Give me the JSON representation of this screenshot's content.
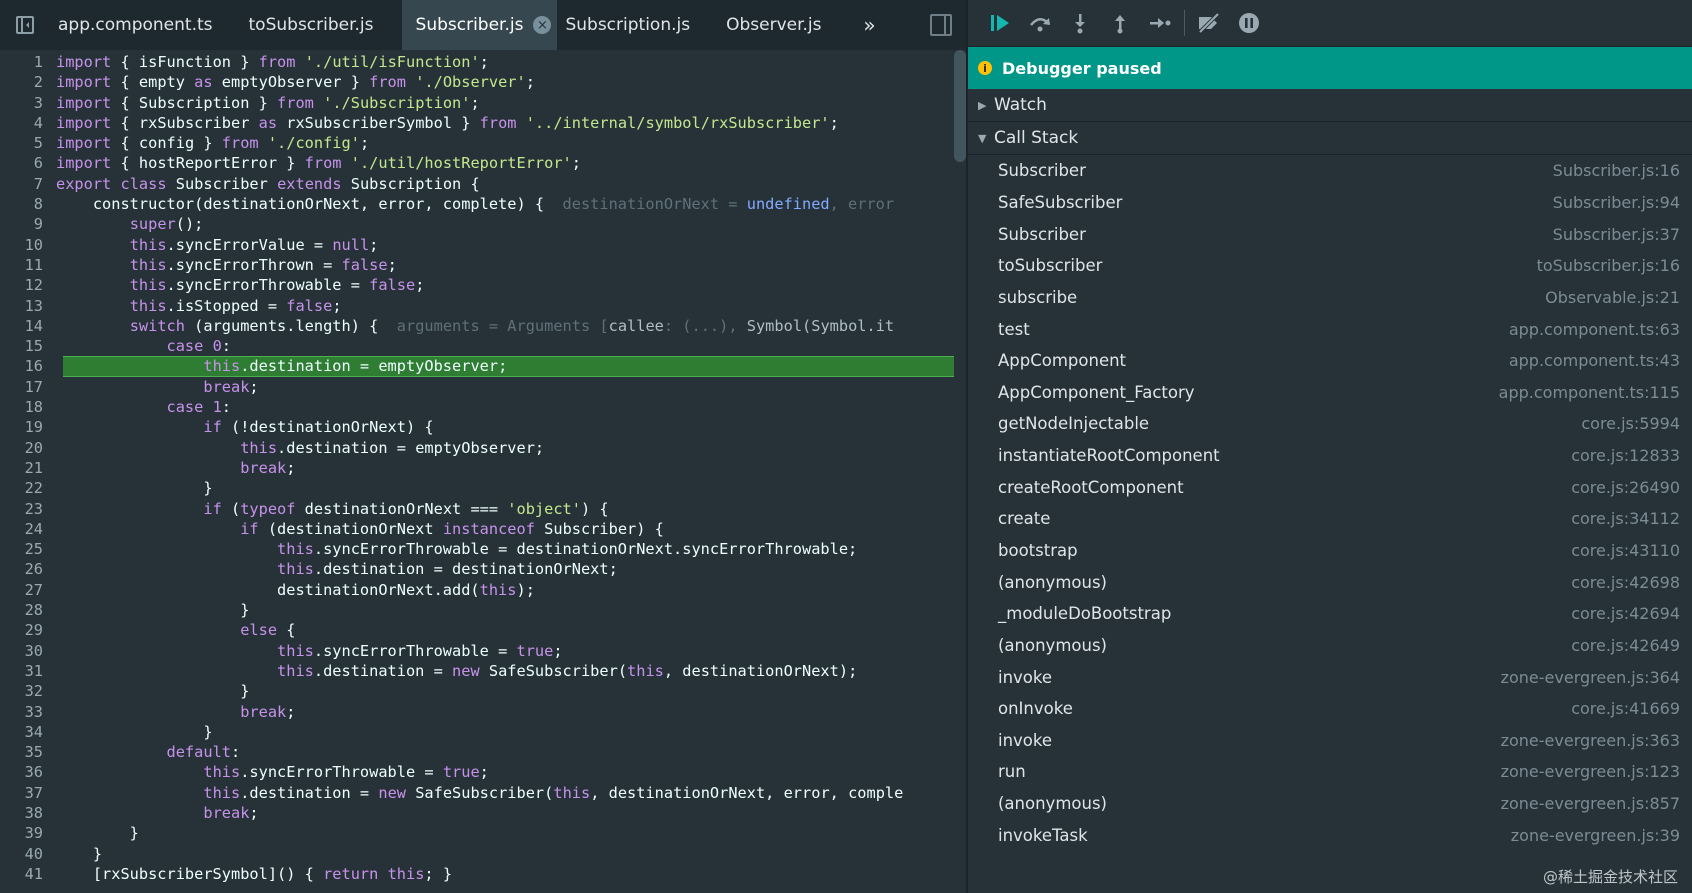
{
  "tabs": [
    {
      "label": "app.component.ts",
      "active": false
    },
    {
      "label": "toSubscriber.js",
      "active": false
    },
    {
      "label": "Subscriber.js",
      "active": true
    },
    {
      "label": "Subscription.js",
      "active": false
    },
    {
      "label": "Observer.js",
      "active": false
    }
  ],
  "tab_overflow_label": "»",
  "tab_close_glyph": "×",
  "code_lines": [
    {
      "n": "1",
      "html": "<span class=\"k\">import</span> { isFunction } <span class=\"k\">from</span> <span class=\"s\">'./util/isFunction'</span>;"
    },
    {
      "n": "2",
      "html": "<span class=\"k\">import</span> { empty <span class=\"k\">as</span> emptyObserver } <span class=\"k\">from</span> <span class=\"s\">'./Observer'</span>;"
    },
    {
      "n": "3",
      "html": "<span class=\"k\">import</span> { Subscription } <span class=\"k\">from</span> <span class=\"s\">'./Subscription'</span>;"
    },
    {
      "n": "4",
      "html": "<span class=\"k\">import</span> { rxSubscriber <span class=\"k\">as</span> rxSubscriberSymbol } <span class=\"k\">from</span> <span class=\"s\">'../internal/symbol/rxSubscriber'</span>;"
    },
    {
      "n": "5",
      "html": "<span class=\"k\">import</span> { config } <span class=\"k\">from</span> <span class=\"s\">'./config'</span>;"
    },
    {
      "n": "6",
      "html": "<span class=\"k\">import</span> { hostReportError } <span class=\"k\">from</span> <span class=\"s\">'./util/hostReportError'</span>;"
    },
    {
      "n": "7",
      "html": "<span class=\"k\">export</span> <span class=\"k\">class</span> Subscriber <span class=\"k\">extends</span> Subscription {"
    },
    {
      "n": "8",
      "html": "    constructor(destinationOrNext, error, complete) {  <span class=\"inl\">destinationOrNext = <span class=\"v\">undefined</span>, error</span>"
    },
    {
      "n": "9",
      "html": "        <span class=\"k\">super</span>();"
    },
    {
      "n": "10",
      "html": "        <span class=\"k\">this</span>.syncErrorValue = <span class=\"k\">null</span>;"
    },
    {
      "n": "11",
      "html": "        <span class=\"k\">this</span>.syncErrorThrown = <span class=\"k\">false</span>;"
    },
    {
      "n": "12",
      "html": "        <span class=\"k\">this</span>.syncErrorThrowable = <span class=\"k\">false</span>;"
    },
    {
      "n": "13",
      "html": "        <span class=\"k\">this</span>.isStopped = <span class=\"k\">false</span>;"
    },
    {
      "n": "14",
      "html": "        <span class=\"k\">switch</span> (arguments.length) {  <span class=\"inl\">arguments = Arguments [<span class=\"w\">callee</span>: (...), <span class=\"w\">Symbol(Symbol.it</span></span>"
    },
    {
      "n": "15",
      "html": "            <span class=\"k\">case</span> <span class=\"k\">0</span>:"
    },
    {
      "n": "16",
      "html": "                <span class=\"k\">this</span>.destination = emptyObserver;",
      "current": true
    },
    {
      "n": "17",
      "html": "                <span class=\"k\">break</span>;"
    },
    {
      "n": "18",
      "html": "            <span class=\"k\">case</span> <span class=\"k\">1</span>:"
    },
    {
      "n": "19",
      "html": "                <span class=\"k\">if</span> (!destinationOrNext) {"
    },
    {
      "n": "20",
      "html": "                    <span class=\"k\">this</span>.destination = emptyObserver;"
    },
    {
      "n": "21",
      "html": "                    <span class=\"k\">break</span>;"
    },
    {
      "n": "22",
      "html": "                }"
    },
    {
      "n": "23",
      "html": "                <span class=\"k\">if</span> (<span class=\"k\">typeof</span> destinationOrNext === <span class=\"s\">'object'</span>) {"
    },
    {
      "n": "24",
      "html": "                    <span class=\"k\">if</span> (destinationOrNext <span class=\"k\">instanceof</span> Subscriber) {"
    },
    {
      "n": "25",
      "html": "                        <span class=\"k\">this</span>.syncErrorThrowable = destinationOrNext.syncErrorThrowable;"
    },
    {
      "n": "26",
      "html": "                        <span class=\"k\">this</span>.destination = destinationOrNext;"
    },
    {
      "n": "27",
      "html": "                        destinationOrNext.add(<span class=\"k\">this</span>);"
    },
    {
      "n": "28",
      "html": "                    }"
    },
    {
      "n": "29",
      "html": "                    <span class=\"k\">else</span> {"
    },
    {
      "n": "30",
      "html": "                        <span class=\"k\">this</span>.syncErrorThrowable = <span class=\"k\">true</span>;"
    },
    {
      "n": "31",
      "html": "                        <span class=\"k\">this</span>.destination = <span class=\"k\">new</span> SafeSubscriber(<span class=\"k\">this</span>, destinationOrNext);"
    },
    {
      "n": "32",
      "html": "                    }"
    },
    {
      "n": "33",
      "html": "                    <span class=\"k\">break</span>;"
    },
    {
      "n": "34",
      "html": "                }"
    },
    {
      "n": "35",
      "html": "            <span class=\"k\">default</span>:"
    },
    {
      "n": "36",
      "html": "                <span class=\"k\">this</span>.syncErrorThrowable = <span class=\"k\">true</span>;"
    },
    {
      "n": "37",
      "html": "                <span class=\"k\">this</span>.destination = <span class=\"k\">new</span> SafeSubscriber(<span class=\"k\">this</span>, destinationOrNext, error, comple"
    },
    {
      "n": "38",
      "html": "                <span class=\"k\">break</span>;"
    },
    {
      "n": "39",
      "html": "        }"
    },
    {
      "n": "40",
      "html": "    }"
    },
    {
      "n": "41",
      "html": "    [rxSubscriberSymbol]() { <span class=\"k\">return</span> <span class=\"k\">this</span>; }"
    }
  ],
  "status": {
    "message": "Debugger paused"
  },
  "sections": {
    "watch": "Watch",
    "call_stack": "Call Stack"
  },
  "call_stack": [
    {
      "fn": "Subscriber",
      "loc": "Subscriber.js:16"
    },
    {
      "fn": "SafeSubscriber",
      "loc": "Subscriber.js:94"
    },
    {
      "fn": "Subscriber",
      "loc": "Subscriber.js:37"
    },
    {
      "fn": "toSubscriber",
      "loc": "toSubscriber.js:16"
    },
    {
      "fn": "subscribe",
      "loc": "Observable.js:21"
    },
    {
      "fn": "test",
      "loc": "app.component.ts:63"
    },
    {
      "fn": "AppComponent",
      "loc": "app.component.ts:43"
    },
    {
      "fn": "AppComponent_Factory",
      "loc": "app.component.ts:115"
    },
    {
      "fn": "getNodeInjectable",
      "loc": "core.js:5994"
    },
    {
      "fn": "instantiateRootComponent",
      "loc": "core.js:12833"
    },
    {
      "fn": "createRootComponent",
      "loc": "core.js:26490"
    },
    {
      "fn": "create",
      "loc": "core.js:34112"
    },
    {
      "fn": "bootstrap",
      "loc": "core.js:43110"
    },
    {
      "fn": "(anonymous)",
      "loc": "core.js:42698"
    },
    {
      "fn": "_moduleDoBootstrap",
      "loc": "core.js:42694"
    },
    {
      "fn": "(anonymous)",
      "loc": "core.js:42649"
    },
    {
      "fn": "invoke",
      "loc": "zone-evergreen.js:364"
    },
    {
      "fn": "onInvoke",
      "loc": "core.js:41669"
    },
    {
      "fn": "invoke",
      "loc": "zone-evergreen.js:363"
    },
    {
      "fn": "run",
      "loc": "zone-evergreen.js:123"
    },
    {
      "fn": "(anonymous)",
      "loc": "zone-evergreen.js:857"
    },
    {
      "fn": "invokeTask",
      "loc": "zone-evergreen.js:39"
    }
  ],
  "watermark": "@稀土掘金技术社区",
  "colors": {
    "accent": "#009688",
    "current_line": "#2e7d32",
    "resume": "#14b8b1"
  }
}
